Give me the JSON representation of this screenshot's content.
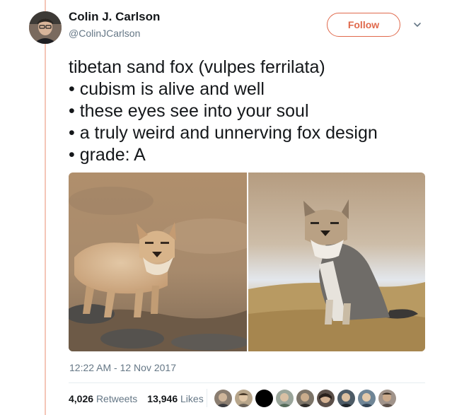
{
  "user": {
    "display_name": "Colin J. Carlson",
    "handle": "@ColinJCarlson",
    "follow_label": "Follow"
  },
  "tweet": {
    "lines": [
      "tibetan sand fox (vulpes ferrilata)",
      "• cubism is alive and well",
      "• these eyes see into your soul",
      "• a truly weird and unnerving fox design",
      "• grade: A"
    ],
    "timestamp": "12:22 AM - 12 Nov 2017"
  },
  "stats": {
    "retweets_count": "4,026",
    "retweets_label": "Retweets",
    "likes_count": "13,946",
    "likes_label": "Likes"
  },
  "colors": {
    "accent": "#e0694c",
    "thread_line": "#f4c6b8",
    "secondary_text": "#657786"
  },
  "icons": {
    "more": "chevron-down-icon"
  }
}
